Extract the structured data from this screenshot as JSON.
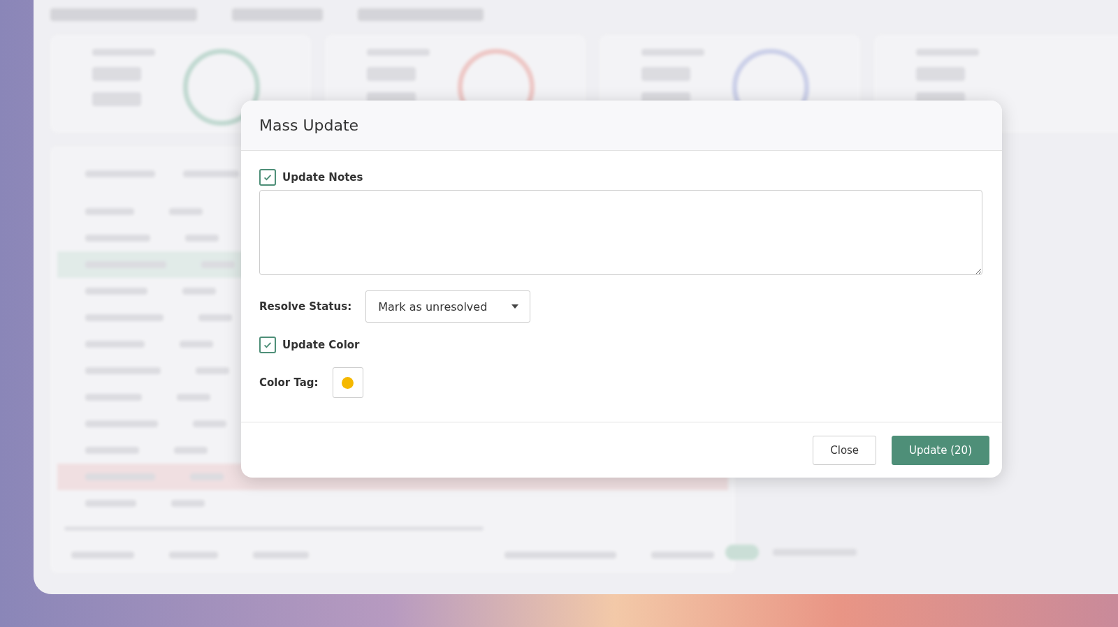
{
  "modal": {
    "title": "Mass Update",
    "update_notes": {
      "label": "Update Notes",
      "checked": true
    },
    "resolve_status": {
      "label": "Resolve Status:",
      "value": "Mark as unresolved"
    },
    "update_color": {
      "label": "Update Color",
      "checked": true
    },
    "color_tag": {
      "label": "Color Tag:",
      "color": "#f5b800"
    },
    "buttons": [
      {
        "label": "Close",
        "kind": "secondary"
      },
      {
        "label": "Update (20)",
        "kind": "primary"
      }
    ]
  }
}
